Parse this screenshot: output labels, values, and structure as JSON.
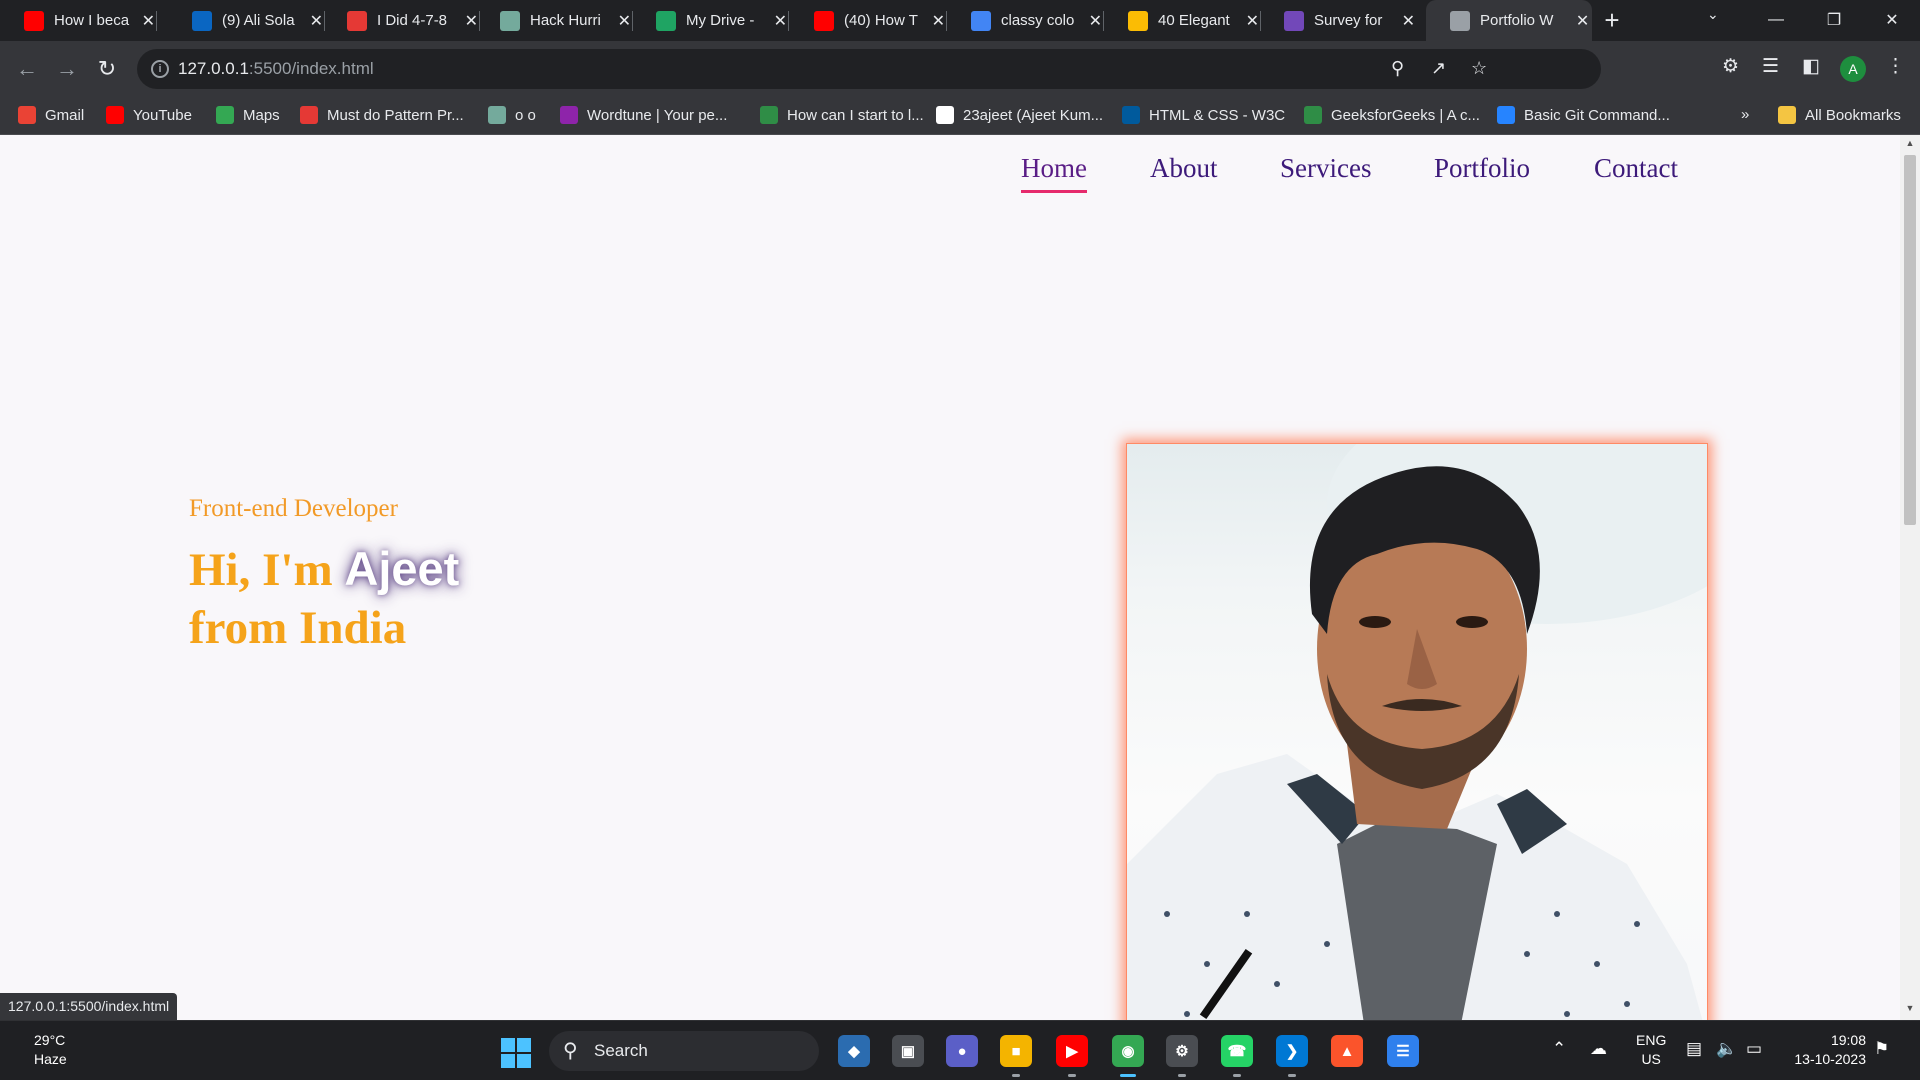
{
  "tabs": [
    {
      "title": "How I beca",
      "icon": "youtube-icon",
      "color": "#ff0000"
    },
    {
      "title": "(9) Ali Sola",
      "icon": "linkedin-icon",
      "color": "#0a66c2"
    },
    {
      "title": "I Did 4-7-8",
      "icon": "b-icon",
      "color": "#e53935"
    },
    {
      "title": "Hack Hurri",
      "icon": "chatgpt-icon",
      "color": "#74aa9c"
    },
    {
      "title": "My Drive -",
      "icon": "google-drive-icon",
      "color": "#1fa463"
    },
    {
      "title": "(40) How T",
      "icon": "youtube-icon",
      "color": "#ff0000"
    },
    {
      "title": "classy colo",
      "icon": "google-icon",
      "color": "#4285f4"
    },
    {
      "title": "40 Elegant",
      "icon": "google-ads-icon",
      "color": "#fbbc04"
    },
    {
      "title": "Survey for",
      "icon": "google-forms-icon",
      "color": "#7248b9"
    },
    {
      "title": "Portfolio W",
      "icon": "globe-icon",
      "color": "#9aa0a6"
    }
  ],
  "address_bar": {
    "host": "127.0.0.1",
    "path": ":5500/index.html"
  },
  "bookmarks": [
    {
      "label": "Gmail",
      "icon": "gmail-icon",
      "color": "#ea4335"
    },
    {
      "label": "YouTube",
      "icon": "youtube-icon",
      "color": "#ff0000"
    },
    {
      "label": "Maps",
      "icon": "maps-icon",
      "color": "#34a853"
    },
    {
      "label": "Must do Pattern Pr...",
      "icon": "tuf-icon",
      "color": "#e53935"
    },
    {
      "label": "o o",
      "icon": "chatgpt-icon",
      "color": "#74aa9c"
    },
    {
      "label": "Wordtune | Your pe...",
      "icon": "wordtune-icon",
      "color": "#8e24aa"
    },
    {
      "label": "How can I start to l...",
      "icon": "gfg-icon",
      "color": "#2f8d46"
    },
    {
      "label": "23ajeet (Ajeet Kum...",
      "icon": "github-icon",
      "color": "#ffffff"
    },
    {
      "label": "HTML & CSS - W3C",
      "icon": "w3c-icon",
      "color": "#005a9c"
    },
    {
      "label": "GeeksforGeeks | A c...",
      "icon": "gfg-icon",
      "color": "#2f8d46"
    },
    {
      "label": "Basic Git Command...",
      "icon": "atlassian-icon",
      "color": "#2684ff"
    }
  ],
  "bookmarks_overflow": "»",
  "all_bookmarks": "All Bookmarks",
  "page": {
    "nav": [
      "Home",
      "About",
      "Services",
      "Portfolio",
      "Contact"
    ],
    "active_nav": "Home",
    "role": "Front-end Developer",
    "greeting": "Hi, I'm",
    "name": "Ajeet",
    "origin": "from India",
    "accent_color": "#f5a31a",
    "nav_color": "#3d1a7a",
    "underline_color": "#e62a6c",
    "photo_glow_color": "#ff7850"
  },
  "status_url": "127.0.0.1:5500/index.html",
  "taskbar": {
    "weather_temp": "29°C",
    "weather_desc": "Haze",
    "search_label": "Search",
    "lang_line1": "ENG",
    "lang_line2": "US",
    "time": "19:08",
    "date": "13-10-2023"
  }
}
